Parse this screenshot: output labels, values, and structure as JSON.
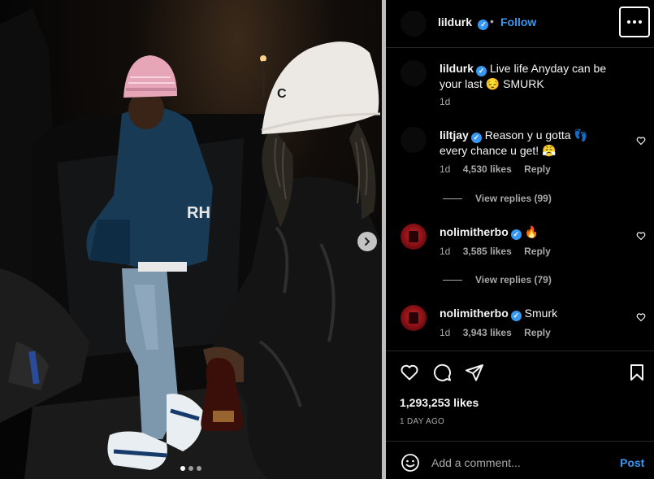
{
  "post": {
    "username": "lildurk",
    "separator": "•",
    "follow_label": "Follow",
    "likes": "1,293,253 likes",
    "time": "1 DAY AGO"
  },
  "caption": {
    "username": "lildurk",
    "text": "Live life Anyday can be your last 😔 SMURK",
    "age": "1d"
  },
  "comments": [
    {
      "username": "liltjay",
      "text": "Reason y u gotta 👣 every chance u get! 😤",
      "age": "1d",
      "likes": "4,530 likes",
      "reply": "Reply",
      "view_replies": "View replies (99)"
    },
    {
      "username": "nolimitherbo",
      "text": "🔥",
      "age": "1d",
      "likes": "3,585 likes",
      "reply": "Reply",
      "view_replies": "View replies (79)"
    },
    {
      "username": "nolimitherbo",
      "text": "Smurk",
      "age": "1d",
      "likes": "3,943 likes",
      "reply": "Reply"
    }
  ],
  "composer": {
    "placeholder": "Add a comment...",
    "post_label": "Post"
  },
  "carousel": {
    "current": 1,
    "total": 3
  },
  "colors": {
    "accent": "#3897f0",
    "verified": "#3897f0"
  },
  "icons": [
    "verified-badge-icon",
    "more-options-icon",
    "heart-icon",
    "comment-icon",
    "share-icon",
    "bookmark-icon",
    "emoji-icon",
    "next-arrow-icon"
  ]
}
